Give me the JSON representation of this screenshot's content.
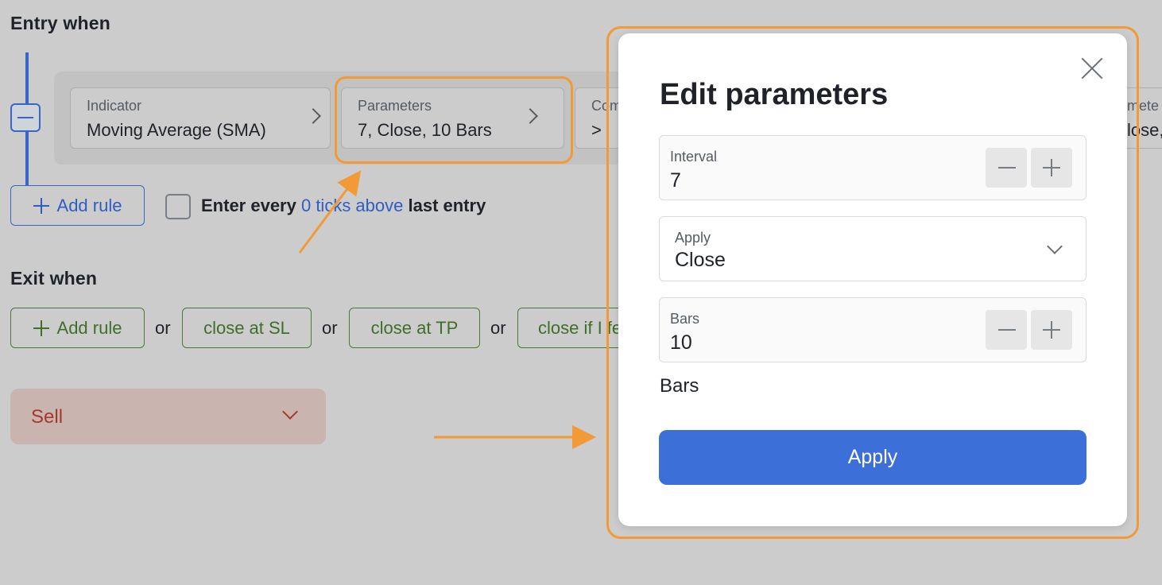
{
  "entry": {
    "title": "Entry when",
    "rule": {
      "indicator": {
        "label": "Indicator",
        "value": "Moving Average (SMA)"
      },
      "parameters": {
        "label": "Parameters",
        "value": "7, Close, 10 Bars"
      },
      "comparison": {
        "label": "Com",
        "value": ">"
      },
      "parameters2": {
        "label": "mete",
        "value": "lose,"
      }
    },
    "add_rule_label": "Add rule",
    "every_text_pre": "Enter every ",
    "every_link": "0 ticks above",
    "every_text_post": " last entry"
  },
  "exit": {
    "title": "Exit when",
    "add_rule_label": "Add rule",
    "or_label": "or",
    "buttons": [
      "close at SL",
      "close at TP",
      "close if I fe"
    ]
  },
  "direction": {
    "value": "Sell"
  },
  "modal": {
    "title": "Edit parameters",
    "interval": {
      "label": "Interval",
      "value": "7"
    },
    "apply_field": {
      "label": "Apply",
      "value": "Close"
    },
    "bars": {
      "label": "Bars",
      "value": "10"
    },
    "bars_note": "Bars",
    "apply_button": "Apply"
  },
  "colors": {
    "accent": "#3d6fd9",
    "highlight": "#f29a36",
    "exit_green": "#3f6e2a",
    "sell_red": "#a33a2a"
  }
}
